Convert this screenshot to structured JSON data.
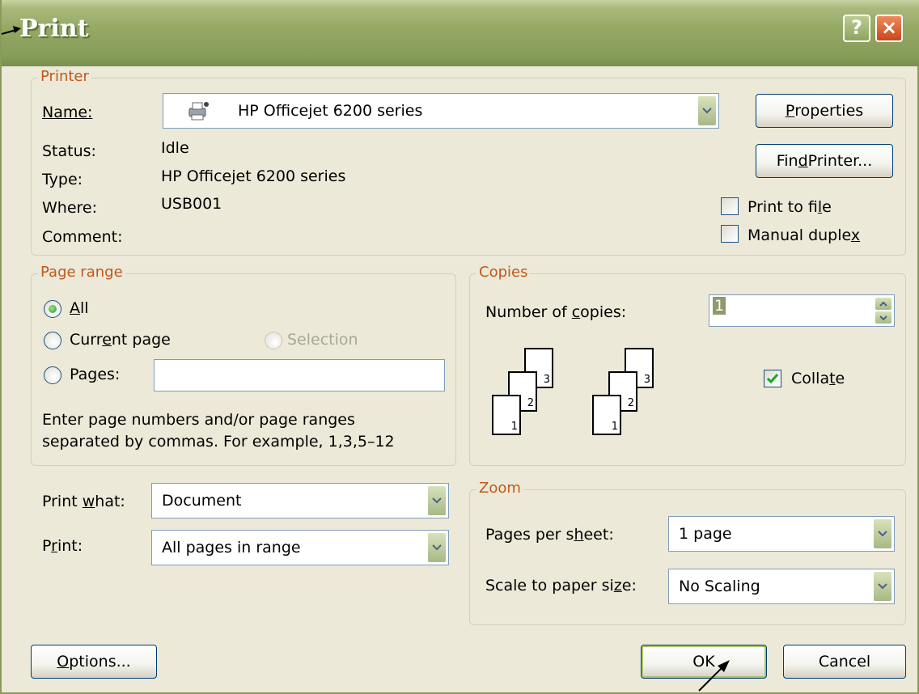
{
  "window": {
    "title": "Print",
    "help_label": "?",
    "close_label": "×"
  },
  "printer": {
    "legend": "Printer",
    "name_label": "Name:",
    "name_value": "HP Officejet 6200 series",
    "status_label": "Status:",
    "status_value": "Idle",
    "type_label": "Type:",
    "type_value": "HP Officejet 6200 series",
    "where_label": "Where:",
    "where_value": "USB001",
    "comment_label": "Comment:",
    "properties_button": {
      "pre": "",
      "key": "P",
      "post": "roperties"
    },
    "find_printer_button": {
      "pre": "Fin",
      "key": "d",
      "post": " Printer..."
    },
    "print_to_file": {
      "pre": "Print to fi",
      "key": "l",
      "post": "e",
      "checked": false
    },
    "manual_duplex": {
      "pre": "Manual duple",
      "key": "x",
      "post": "",
      "checked": false
    }
  },
  "page_range": {
    "legend": "Page range",
    "all": {
      "pre": "",
      "key": "A",
      "post": "ll",
      "selected": true
    },
    "current_page": {
      "pre": "Curr",
      "key": "e",
      "post": "nt page",
      "selected": false
    },
    "selection": {
      "label": "Selection",
      "enabled": false
    },
    "pages": {
      "pre": "Pa",
      "key": "g",
      "post": "es:",
      "selected": false,
      "value": ""
    },
    "help_line1": "Enter page numbers and/or page ranges",
    "help_line2": "separated by commas.  For example, 1,3,5–12"
  },
  "copies": {
    "legend": "Copies",
    "number_label": {
      "pre": "Number of ",
      "key": "c",
      "post": "opies:"
    },
    "number_value": "1",
    "collate": {
      "pre": "Colla",
      "key": "t",
      "post": "e",
      "checked": true
    },
    "page_numbers": [
      "1",
      "2",
      "3"
    ]
  },
  "print_what": {
    "pre": "Print ",
    "key": "w",
    "post": "hat:",
    "value": "Document"
  },
  "print": {
    "pre": "P",
    "key": "r",
    "post": "int:",
    "value": "All pages in range"
  },
  "zoom": {
    "legend": "Zoom",
    "pages_per_sheet": {
      "pre": "Pages per s",
      "key": "h",
      "post": "eet:",
      "value": "1 page"
    },
    "scale": {
      "pre": "Scale to paper si",
      "key": "z",
      "post": "e:",
      "value": "No Scaling"
    }
  },
  "buttons": {
    "options": {
      "pre": "",
      "key": "O",
      "post": "ptions..."
    },
    "ok": "OK",
    "cancel": "Cancel"
  },
  "colors": {
    "title_bar": "#869c58",
    "dialog_bg": "#ECE9D8",
    "legend": "#c1581b",
    "border": "#7f9db9"
  }
}
